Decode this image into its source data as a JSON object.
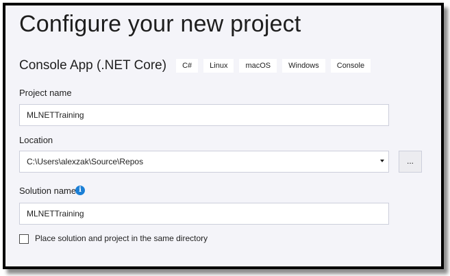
{
  "page": {
    "title": "Configure your new project"
  },
  "template": {
    "name": "Console App (.NET Core)",
    "tags": [
      "C#",
      "Linux",
      "macOS",
      "Windows",
      "Console"
    ]
  },
  "project_name": {
    "label": "Project name",
    "value": "MLNETTraining"
  },
  "location": {
    "label": "Location",
    "value": "C:\\Users\\alexzak\\Source\\Repos",
    "browse_label": "..."
  },
  "solution_name": {
    "label": "Solution name",
    "info_glyph": "i",
    "value": "MLNETTraining"
  },
  "same_directory": {
    "label": "Place solution and project in the same directory",
    "checked": false
  },
  "colors": {
    "background": "#f4f4f9",
    "accent_info": "#1b7fd6",
    "text": "#1e1e1e"
  }
}
